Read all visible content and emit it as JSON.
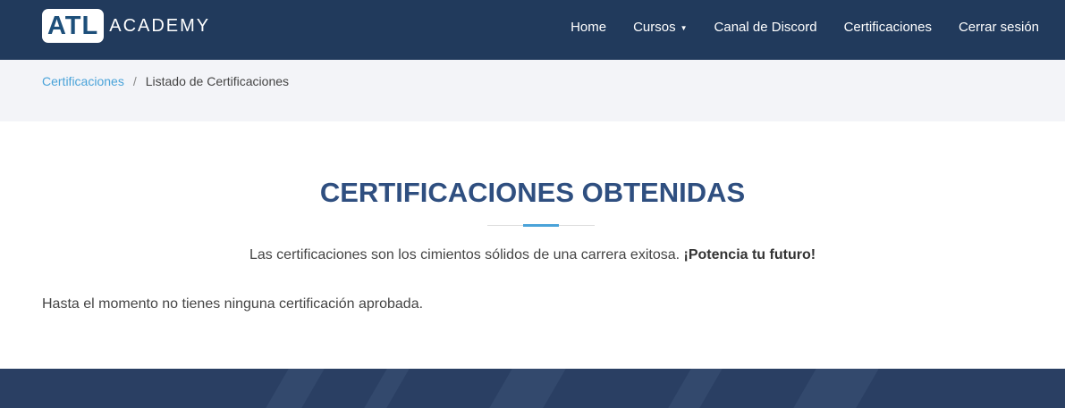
{
  "brand": {
    "logo_mark": "ATL",
    "logo_word": "ACADEMY"
  },
  "nav": {
    "items": [
      {
        "label": "Home"
      },
      {
        "label": "Cursos",
        "caret": "▼"
      },
      {
        "label": "Canal de Discord"
      },
      {
        "label": "Certificaciones"
      },
      {
        "label": "Cerrar sesión"
      }
    ]
  },
  "breadcrumb": {
    "link": "Certificaciones",
    "separator": "/",
    "current": "Listado de Certificaciones"
  },
  "main": {
    "title": "CERTIFICACIONES OBTENIDAS",
    "tagline_text": "Las certificaciones son los cimientos sólidos de una carrera exitosa. ",
    "tagline_bold": "¡Potencia tu futuro!",
    "empty_message": "Hasta el momento no tienes ninguna certificación aprobada."
  },
  "colors": {
    "navbar": "#213a5c",
    "accent": "#4aa3d9",
    "title": "#2f4f80",
    "footer": "#2a3f63"
  }
}
